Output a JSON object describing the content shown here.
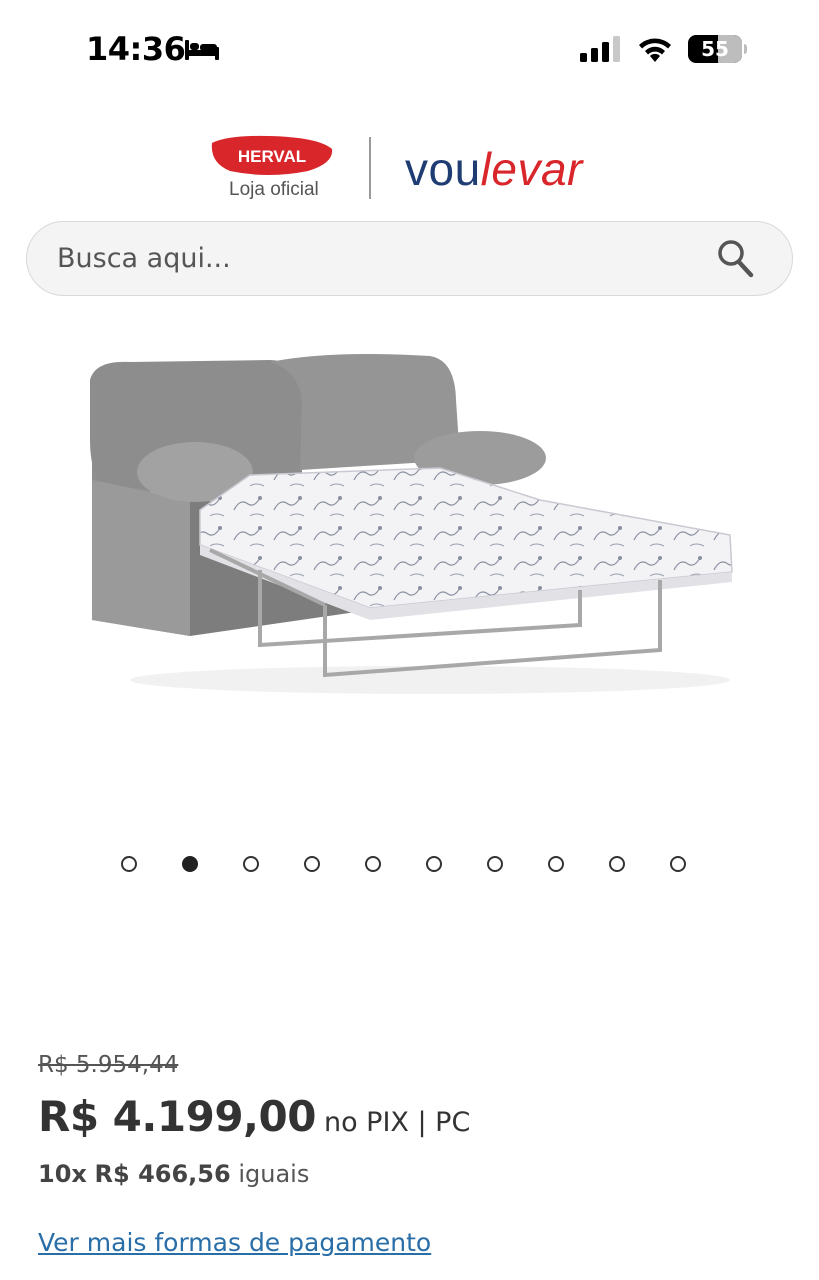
{
  "status_bar": {
    "time": "14:36",
    "battery_level": "55",
    "battery_percent": 55,
    "icons": [
      "bed-icon",
      "signal-icon",
      "wifi-icon",
      "battery-icon"
    ]
  },
  "header": {
    "brand_logo_text": "HERVAL",
    "brand_subtitle": "Loja oficial",
    "store_name_part1": "vou",
    "store_name_part2": "levar",
    "colors": {
      "herval_red": "#d8262b",
      "voulevar_blue": "#1f3d73",
      "voulevar_red": "#d8262b"
    }
  },
  "search": {
    "placeholder": "Busca aqui...",
    "value": "",
    "icon": "search-icon"
  },
  "carousel": {
    "total": 10,
    "active_index": 1
  },
  "pricing": {
    "old_price": "R$ 5.954,44",
    "price": "R$ 4.199,00",
    "price_suffix": "no PIX | PC",
    "installments_count": "10x",
    "installment_value": "R$ 466,56",
    "installments_suffix": "iguais",
    "more_payments_link": "Ver mais formas de pagamento",
    "link_color": "#2a6ea8"
  }
}
